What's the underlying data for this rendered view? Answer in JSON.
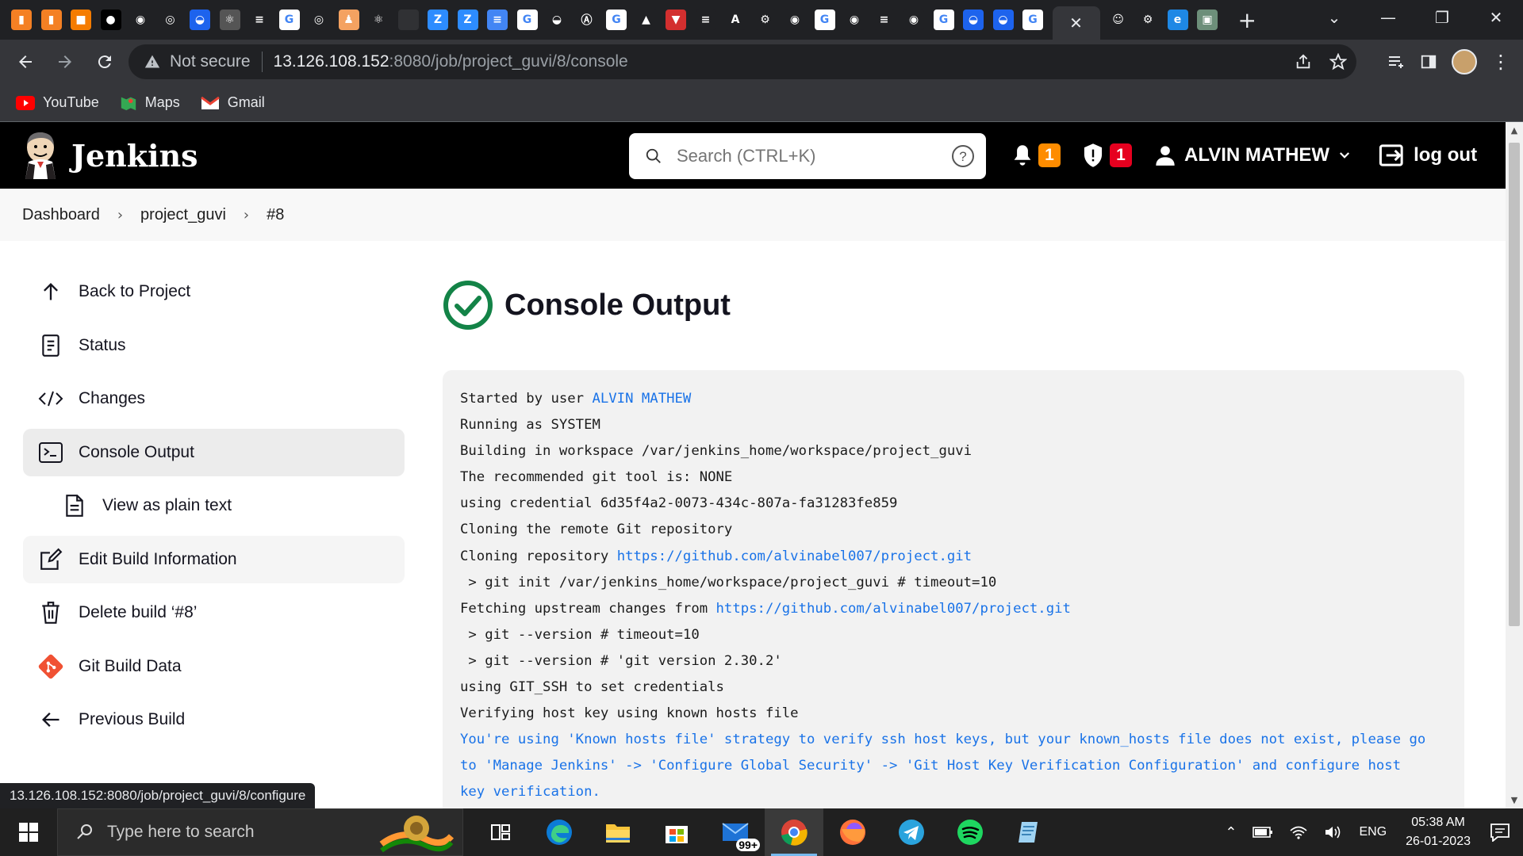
{
  "browser": {
    "tabs_favicons": [
      {
        "icon": "stackoverflow-icon",
        "bg": "#f48024",
        "glyph": "▮"
      },
      {
        "icon": "stackoverflow-icon",
        "bg": "#f48024",
        "glyph": "▮"
      },
      {
        "icon": "box-icon",
        "bg": "#f57c00",
        "glyph": "■"
      },
      {
        "icon": "medium-icon",
        "bg": "#000000",
        "glyph": "●"
      },
      {
        "icon": "github-icon",
        "bg": "#202124",
        "glyph": "◉"
      },
      {
        "icon": "chrome-icon",
        "bg": "#202124",
        "glyph": "◎"
      },
      {
        "icon": "docker-icon",
        "bg": "#1d63ed",
        "glyph": "◒"
      },
      {
        "icon": "react-icon",
        "bg": "#555555",
        "glyph": "⚛"
      },
      {
        "icon": "stackoverflow-icon",
        "bg": "#202124",
        "glyph": "≡"
      },
      {
        "icon": "google-icon",
        "bg": "#ffffff",
        "glyph": "G"
      },
      {
        "icon": "chrome-icon",
        "bg": "#202124",
        "glyph": "◎"
      },
      {
        "icon": "person-icon",
        "bg": "#f4a261",
        "glyph": "♟"
      },
      {
        "icon": "react-icon",
        "bg": "#202124",
        "glyph": "⚛"
      },
      {
        "icon": "blank-icon",
        "bg": "#303134",
        "glyph": ""
      },
      {
        "icon": "zoom-icon",
        "bg": "#2d8cff",
        "glyph": "Z"
      },
      {
        "icon": "zoom-icon",
        "bg": "#2d8cff",
        "glyph": "Z"
      },
      {
        "icon": "docs-icon",
        "bg": "#4285f4",
        "glyph": "≡"
      },
      {
        "icon": "google-icon",
        "bg": "#ffffff",
        "glyph": "G"
      },
      {
        "icon": "docker-icon",
        "bg": "#202124",
        "glyph": "◒"
      },
      {
        "icon": "ansible-icon",
        "bg": "#202124",
        "glyph": "Ⓐ"
      },
      {
        "icon": "google-icon",
        "bg": "#ffffff",
        "glyph": "G"
      },
      {
        "icon": "gdrive-icon",
        "bg": "#202124",
        "glyph": "▲"
      },
      {
        "icon": "vercel-icon",
        "bg": "#d32f2f",
        "glyph": "▼"
      },
      {
        "icon": "stackoverflow-icon",
        "bg": "#202124",
        "glyph": "≡"
      },
      {
        "icon": "azure-icon",
        "bg": "#202124",
        "glyph": "A"
      },
      {
        "icon": "gear-icon",
        "bg": "#202124",
        "glyph": "⚙"
      },
      {
        "icon": "github-icon",
        "bg": "#202124",
        "glyph": "◉"
      },
      {
        "icon": "google-icon",
        "bg": "#ffffff",
        "glyph": "G"
      },
      {
        "icon": "github-icon",
        "bg": "#202124",
        "glyph": "◉"
      },
      {
        "icon": "stackoverflow-icon",
        "bg": "#202124",
        "glyph": "≡"
      },
      {
        "icon": "github-icon",
        "bg": "#202124",
        "glyph": "◉"
      },
      {
        "icon": "google-icon",
        "bg": "#ffffff",
        "glyph": "G"
      },
      {
        "icon": "docker-icon",
        "bg": "#1d63ed",
        "glyph": "◒"
      },
      {
        "icon": "docker-icon",
        "bg": "#1d63ed",
        "glyph": "◒"
      },
      {
        "icon": "google-icon",
        "bg": "#ffffff",
        "glyph": "G"
      }
    ],
    "tabs_after": [
      {
        "icon": "jenkins-icon",
        "bg": "#202124",
        "glyph": "☺"
      },
      {
        "icon": "gear-icon",
        "bg": "#202124",
        "glyph": "⚙"
      },
      {
        "icon": "edureka-icon",
        "bg": "#1e88e5",
        "glyph": "e"
      },
      {
        "icon": "photo-icon",
        "bg": "#6d8f7a",
        "glyph": "▣"
      }
    ],
    "address": {
      "security": "Not secure",
      "host": "13.126.108.152",
      "path": ":8080/job/project_guvi/8/console"
    },
    "bookmarks": [
      {
        "label": "YouTube",
        "icon": "youtube-icon",
        "color": "#ff0000"
      },
      {
        "label": "Maps",
        "icon": "maps-icon",
        "color": "#34a853"
      },
      {
        "label": "Gmail",
        "icon": "gmail-icon",
        "color": "#ea4335"
      }
    ],
    "status_url": "13.126.108.152:8080/job/project_guvi/8/configure"
  },
  "jenkins": {
    "brand": "Jenkins",
    "search_placeholder": "Search (CTRL+K)",
    "notifications_count": "1",
    "security_count": "1",
    "user": "ALVIN MATHEW",
    "logout": "log out",
    "colors": {
      "accent": "#1a73e8",
      "success": "#138347",
      "badge_orange": "#fe8c00",
      "badge_red": "#e6001f"
    }
  },
  "breadcrumb": [
    "Dashboard",
    "project_guvi",
    "#8"
  ],
  "sidebar": [
    {
      "label": "Back to Project",
      "icon": "arrow-up-icon"
    },
    {
      "label": "Status",
      "icon": "document-icon"
    },
    {
      "label": "Changes",
      "icon": "code-icon"
    },
    {
      "label": "Console Output",
      "icon": "terminal-icon"
    },
    {
      "label": "View as plain text",
      "icon": "file-text-icon"
    },
    {
      "label": "Edit Build Information",
      "icon": "edit-icon"
    },
    {
      "label": "Delete build ‘#8’",
      "icon": "trash-icon"
    },
    {
      "label": "Git Build Data",
      "icon": "git-icon"
    },
    {
      "label": "Previous Build",
      "icon": "arrow-left-icon"
    }
  ],
  "main": {
    "title": "Console Output",
    "console": [
      {
        "text": "Started by user ",
        "link": "ALVIN MATHEW",
        "after": ""
      },
      {
        "text": "Running as SYSTEM"
      },
      {
        "text": "Building in workspace /var/jenkins_home/workspace/project_guvi"
      },
      {
        "text": "The recommended git tool is: NONE"
      },
      {
        "text": "using credential 6d35f4a2-0073-434c-807a-fa31283fe859"
      },
      {
        "text": "Cloning the remote Git repository"
      },
      {
        "text": "Cloning repository ",
        "link": "https://github.com/alvinabel007/project.git",
        "after": ""
      },
      {
        "text": " > git init /var/jenkins_home/workspace/project_guvi # timeout=10"
      },
      {
        "text": "Fetching upstream changes from ",
        "link": "https://github.com/alvinabel007/project.git",
        "after": ""
      },
      {
        "text": " > git --version # timeout=10"
      },
      {
        "text": " > git --version # 'git version 2.30.2'"
      },
      {
        "text": "using GIT_SSH to set credentials"
      },
      {
        "text": "Verifying host key using known hosts file"
      },
      {
        "warn": "You're using 'Known hosts file' strategy to verify ssh host keys, but your known_hosts file does not exist, please go"
      },
      {
        "warn": "to 'Manage Jenkins' -> 'Configure Global Security' -> 'Git Host Key Verification Configuration' and configure host"
      },
      {
        "warn": "key verification."
      }
    ]
  },
  "taskbar": {
    "search_placeholder": "Type here to search",
    "mail_badge": "99+",
    "language": "ENG",
    "time": "05:38 AM",
    "date": "26-01-2023",
    "apps": [
      {
        "icon": "task-view-icon"
      },
      {
        "icon": "edge-icon"
      },
      {
        "icon": "file-explorer-icon"
      },
      {
        "icon": "microsoft-store-icon"
      },
      {
        "icon": "mail-icon"
      },
      {
        "icon": "chrome-icon",
        "active": true
      },
      {
        "icon": "firefox-icon"
      },
      {
        "icon": "telegram-icon"
      },
      {
        "icon": "spotify-icon"
      },
      {
        "icon": "notepad-icon"
      }
    ]
  }
}
